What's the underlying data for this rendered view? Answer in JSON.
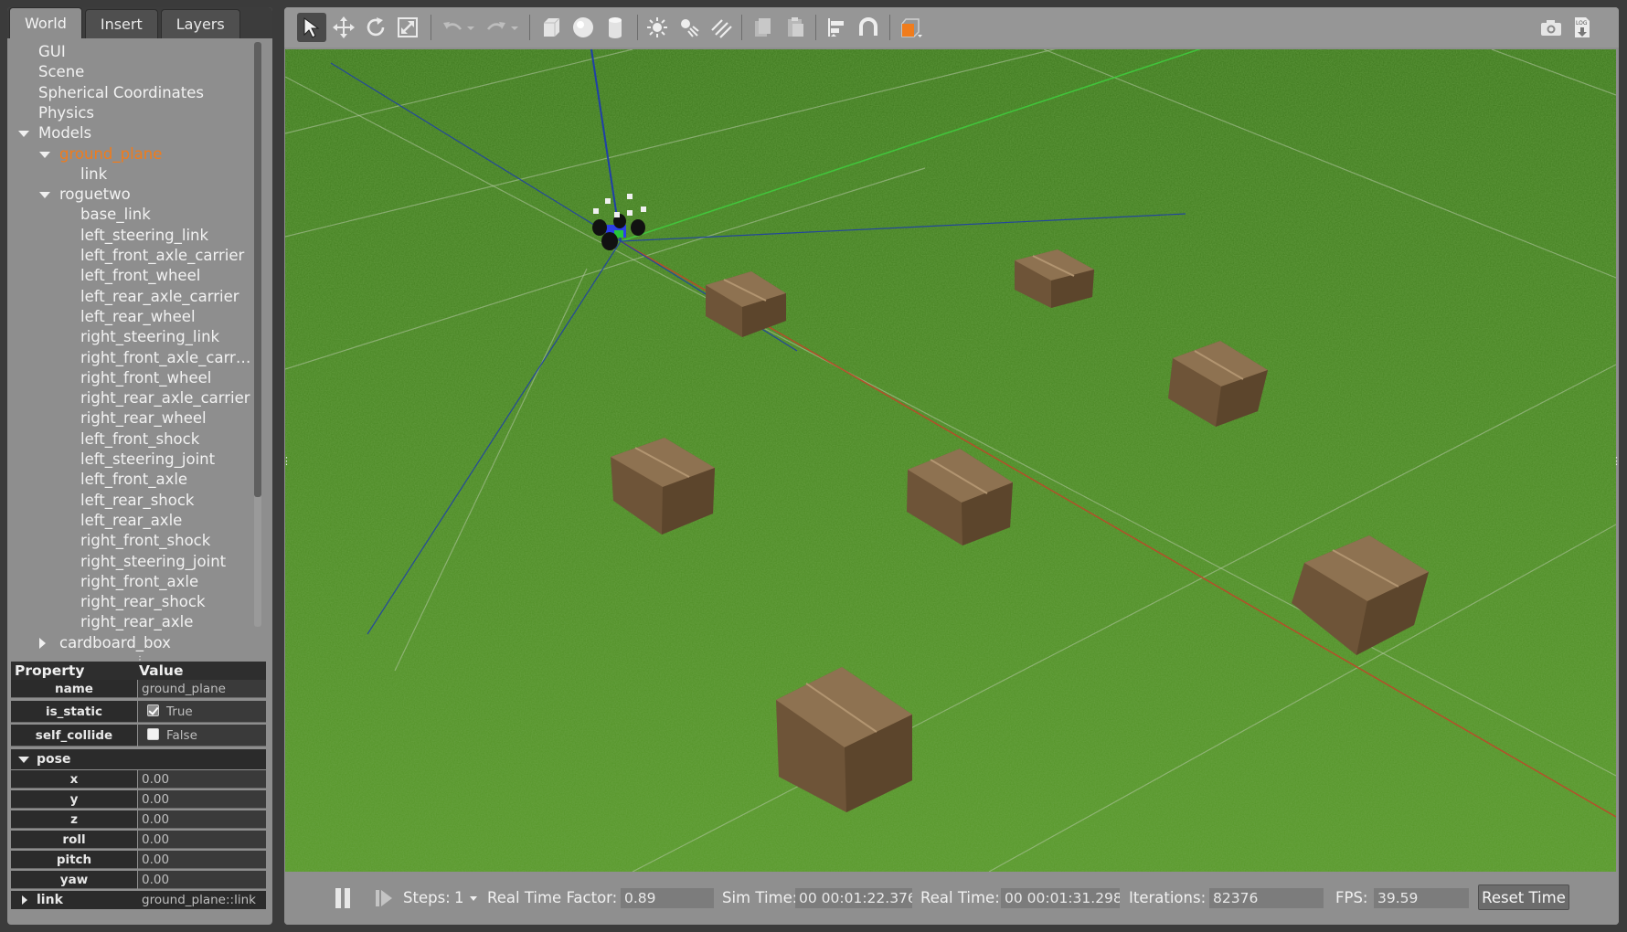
{
  "tabs": [
    "World",
    "Insert",
    "Layers"
  ],
  "tree": [
    {
      "label": "GUI",
      "indent": 0,
      "caret": "none",
      "highlight": false
    },
    {
      "label": "Scene",
      "indent": 0,
      "caret": "none",
      "highlight": false
    },
    {
      "label": "Spherical Coordinates",
      "indent": 0,
      "caret": "none",
      "highlight": false
    },
    {
      "label": "Physics",
      "indent": 0,
      "caret": "none",
      "highlight": false
    },
    {
      "label": "Models",
      "indent": 0,
      "caret": "down",
      "highlight": false
    },
    {
      "label": "ground_plane",
      "indent": 1,
      "caret": "down",
      "highlight": true
    },
    {
      "label": "link",
      "indent": 2,
      "caret": "none",
      "highlight": false
    },
    {
      "label": "roguetwo",
      "indent": 1,
      "caret": "down",
      "highlight": false
    },
    {
      "label": "base_link",
      "indent": 2,
      "caret": "none",
      "highlight": false
    },
    {
      "label": "left_steering_link",
      "indent": 2,
      "caret": "none",
      "highlight": false
    },
    {
      "label": "left_front_axle_carrier",
      "indent": 2,
      "caret": "none",
      "highlight": false
    },
    {
      "label": "left_front_wheel",
      "indent": 2,
      "caret": "none",
      "highlight": false
    },
    {
      "label": "left_rear_axle_carrier",
      "indent": 2,
      "caret": "none",
      "highlight": false
    },
    {
      "label": "left_rear_wheel",
      "indent": 2,
      "caret": "none",
      "highlight": false
    },
    {
      "label": "right_steering_link",
      "indent": 2,
      "caret": "none",
      "highlight": false
    },
    {
      "label": "right_front_axle_carr…",
      "indent": 2,
      "caret": "none",
      "highlight": false
    },
    {
      "label": "right_front_wheel",
      "indent": 2,
      "caret": "none",
      "highlight": false
    },
    {
      "label": "right_rear_axle_carrier",
      "indent": 2,
      "caret": "none",
      "highlight": false
    },
    {
      "label": "right_rear_wheel",
      "indent": 2,
      "caret": "none",
      "highlight": false
    },
    {
      "label": "left_front_shock",
      "indent": 2,
      "caret": "none",
      "highlight": false
    },
    {
      "label": "left_steering_joint",
      "indent": 2,
      "caret": "none",
      "highlight": false
    },
    {
      "label": "left_front_axle",
      "indent": 2,
      "caret": "none",
      "highlight": false
    },
    {
      "label": "left_rear_shock",
      "indent": 2,
      "caret": "none",
      "highlight": false
    },
    {
      "label": "left_rear_axle",
      "indent": 2,
      "caret": "none",
      "highlight": false
    },
    {
      "label": "right_front_shock",
      "indent": 2,
      "caret": "none",
      "highlight": false
    },
    {
      "label": "right_steering_joint",
      "indent": 2,
      "caret": "none",
      "highlight": false
    },
    {
      "label": "right_front_axle",
      "indent": 2,
      "caret": "none",
      "highlight": false
    },
    {
      "label": "right_rear_shock",
      "indent": 2,
      "caret": "none",
      "highlight": false
    },
    {
      "label": "right_rear_axle",
      "indent": 2,
      "caret": "none",
      "highlight": false
    },
    {
      "label": "cardboard_box",
      "indent": 1,
      "caret": "right",
      "highlight": false
    }
  ],
  "properties": {
    "header_property": "Property",
    "header_value": "Value",
    "name_label": "name",
    "name_value": "ground_plane",
    "is_static_label": "is_static",
    "is_static_value": "True",
    "self_collide_label": "self_collide",
    "self_collide_value": "False",
    "pose_label": "pose",
    "x_label": "x",
    "x_value": "0.00",
    "y_label": "y",
    "y_value": "0.00",
    "z_label": "z",
    "z_value": "0.00",
    "roll_label": "roll",
    "roll_value": "0.00",
    "pitch_label": "pitch",
    "pitch_value": "0.00",
    "yaw_label": "yaw",
    "yaw_value": "0.00",
    "link_label": "link",
    "link_value": "ground_plane::link"
  },
  "toolbar_icons": [
    "select-arrow-icon",
    "translate-icon",
    "rotate-icon",
    "scale-icon",
    "undo-icon",
    "undo-history-icon",
    "redo-icon",
    "redo-history-icon",
    "box-shape-icon",
    "sphere-shape-icon",
    "cylinder-shape-icon",
    "point-light-icon",
    "spot-light-icon",
    "directional-light-icon",
    "copy-icon",
    "paste-icon",
    "align-icon",
    "snap-magnet-icon",
    "view-angle-icon",
    "screenshot-camera-icon",
    "log-record-icon"
  ],
  "status": {
    "steps_label": "Steps:",
    "steps_value": "1",
    "rtf_label": "Real Time Factor:",
    "rtf_value": "0.89",
    "sim_time_label": "Sim Time:",
    "sim_time_value": "00 00:01:22.376",
    "real_time_label": "Real Time:",
    "real_time_value": "00 00:01:31.298",
    "iterations_label": "Iterations:",
    "iterations_value": "82376",
    "fps_label": "FPS:",
    "fps_value": "39.59",
    "reset_label": "Reset Time"
  },
  "colors": {
    "highlight": "#f07c1c",
    "ground": "#4f8a24",
    "box": "#7a5e3f",
    "axis_x": "#c0462a",
    "axis_y": "#3fd13f",
    "axis_z": "#1f3fa8"
  }
}
